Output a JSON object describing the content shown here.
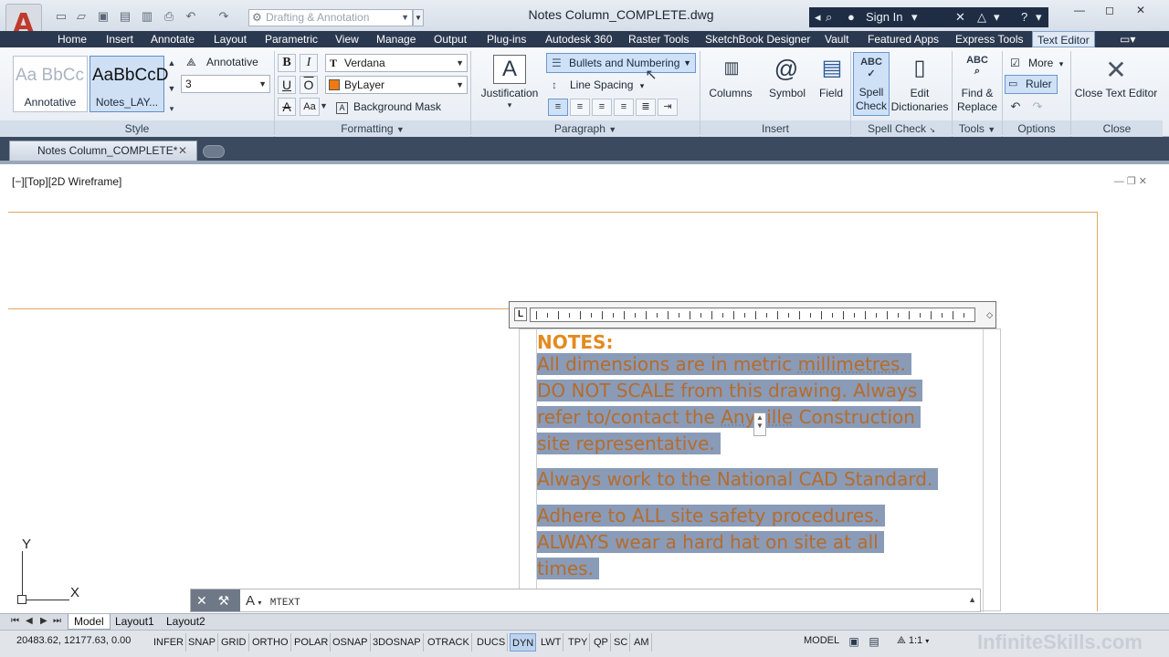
{
  "titlebar": {
    "workspace": "Drafting & Annotation",
    "document_title": "Notes Column_COMPLETE.dwg",
    "sign_in": "Sign In",
    "help": "?"
  },
  "ribbon_tabs": [
    "Home",
    "Insert",
    "Annotate",
    "Layout",
    "Parametric",
    "View",
    "Manage",
    "Output",
    "Plug-ins",
    "Autodesk 360",
    "Raster Tools",
    "SketchBook Designer",
    "Vault",
    "Featured Apps",
    "Express Tools",
    "Text Editor"
  ],
  "style_panel": {
    "swatch1_sample": "Aa BbCc",
    "swatch1_label": "Annotative",
    "swatch2_sample": "AaBbCcD",
    "swatch2_label": "Notes_LAY...",
    "annotative_toggle": "Annotative",
    "text_height": "3",
    "title": "Style"
  },
  "formatting_panel": {
    "bold": "B",
    "italic": "I",
    "underline": "U",
    "overline": "O",
    "font": "Verdana",
    "font_prefix": "T",
    "color": "ByLayer",
    "color_swatch": "#f07a10",
    "strike": "A",
    "case": "Aa",
    "background_mask": "Background Mask",
    "title": "Formatting"
  },
  "paragraph_panel": {
    "justification": "Justification",
    "bullets": "Bullets and Numbering",
    "line_spacing": "Line Spacing",
    "title": "Paragraph"
  },
  "insert_panel": {
    "columns": "Columns",
    "symbol": "Symbol",
    "field": "Field",
    "title": "Insert"
  },
  "spell_panel": {
    "spell_check_line1": "Spell",
    "spell_check_line2": "Check",
    "edit_dict_line1": "Edit",
    "edit_dict_line2": "Dictionaries",
    "title": "Spell Check"
  },
  "tools_panel": {
    "find_line1": "Find &",
    "find_line2": "Replace",
    "title": "Tools"
  },
  "options_panel": {
    "more": "More",
    "ruler": "Ruler",
    "title": "Options"
  },
  "close_panel": {
    "close_editor": "Close Text Editor",
    "title": "Close"
  },
  "doc_tab": "Notes Column_COMPLETE*",
  "viewport_label": "[−][Top][2D Wireframe]",
  "mtext": {
    "heading": "NOTES:",
    "p1_l1": "All dimensions are in metric ",
    "p1_l1_ul": "millimetres",
    "p1_l1_end": ".",
    "p1_l2": "DO NOT SCALE from this drawing. Always",
    "p1_l3a": "refer to/contact the ",
    "p1_l3_ul": "Anyville",
    "p1_l3b": " Construction",
    "p1_l4": "site representative.",
    "p2": "Always work to the National CAD Standard.",
    "p3_l1": "Adhere to ALL site safety procedures.",
    "p3_l2": "ALWAYS wear a hard hat on site at all",
    "p3_l3": "times."
  },
  "ucs": {
    "x": "X",
    "y": "Y"
  },
  "command_line": {
    "prompt": "A",
    "command": "MTEXT"
  },
  "layout_tabs": [
    "Model",
    "Layout1",
    "Layout2"
  ],
  "statusbar": {
    "coords": "20483.62, 12177.63, 0.00",
    "toggles": [
      "INFER",
      "SNAP",
      "GRID",
      "ORTHO",
      "POLAR",
      "OSNAP",
      "3DOSNAP",
      "OTRACK",
      "DUCS",
      "DYN",
      "LWT",
      "TPY",
      "QP",
      "SC",
      "AM"
    ],
    "active_toggle": "DYN",
    "model": "MODEL",
    "scale": "1:1"
  },
  "watermark": "InfiniteSkills.com"
}
